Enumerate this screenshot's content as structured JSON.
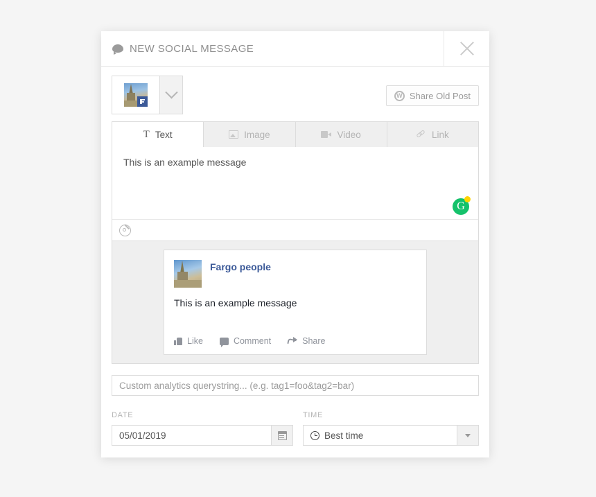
{
  "header": {
    "title": "NEW SOCIAL MESSAGE",
    "bubble_icon": "speech-bubble-icon",
    "close_icon": "close-icon"
  },
  "account": {
    "avatar_icon": "facebook-page-avatar",
    "network_badge": "facebook-badge-icon",
    "caret_icon": "chevron-down-icon"
  },
  "share_old_post": {
    "label": "Share Old Post",
    "icon": "wordpress-icon",
    "icon_glyph": "W"
  },
  "tabs": [
    {
      "label": "Text",
      "icon": "text-icon",
      "active": true
    },
    {
      "label": "Image",
      "icon": "image-icon",
      "active": false
    },
    {
      "label": "Video",
      "icon": "video-icon",
      "active": false
    },
    {
      "label": "Link",
      "icon": "link-icon",
      "active": false
    }
  ],
  "composer": {
    "message": "This is an example message",
    "grammarly_icon": "grammarly-icon",
    "grammarly_glyph": "G",
    "grammarly_color": "#15c26b",
    "grammarly_badge_color": "#ffd400",
    "target_icon": "target-icon"
  },
  "preview": {
    "page_name": "Fargo people",
    "page_name_color": "#3b5998",
    "message": "This is an example message",
    "avatar_icon": "facebook-page-avatar",
    "actions": [
      {
        "label": "Like",
        "icon": "thumbs-up-icon"
      },
      {
        "label": "Comment",
        "icon": "comment-icon"
      },
      {
        "label": "Share",
        "icon": "share-arrow-icon"
      }
    ]
  },
  "analytics": {
    "placeholder": "Custom analytics querystring... (e.g. tag1=foo&tag2=bar)",
    "value": ""
  },
  "schedule": {
    "date_label": "DATE",
    "date_value": "05/01/2019",
    "calendar_icon": "calendar-icon",
    "time_label": "TIME",
    "time_value": "Best time",
    "clock_icon": "clock-icon",
    "time_caret_icon": "caret-down-icon"
  }
}
